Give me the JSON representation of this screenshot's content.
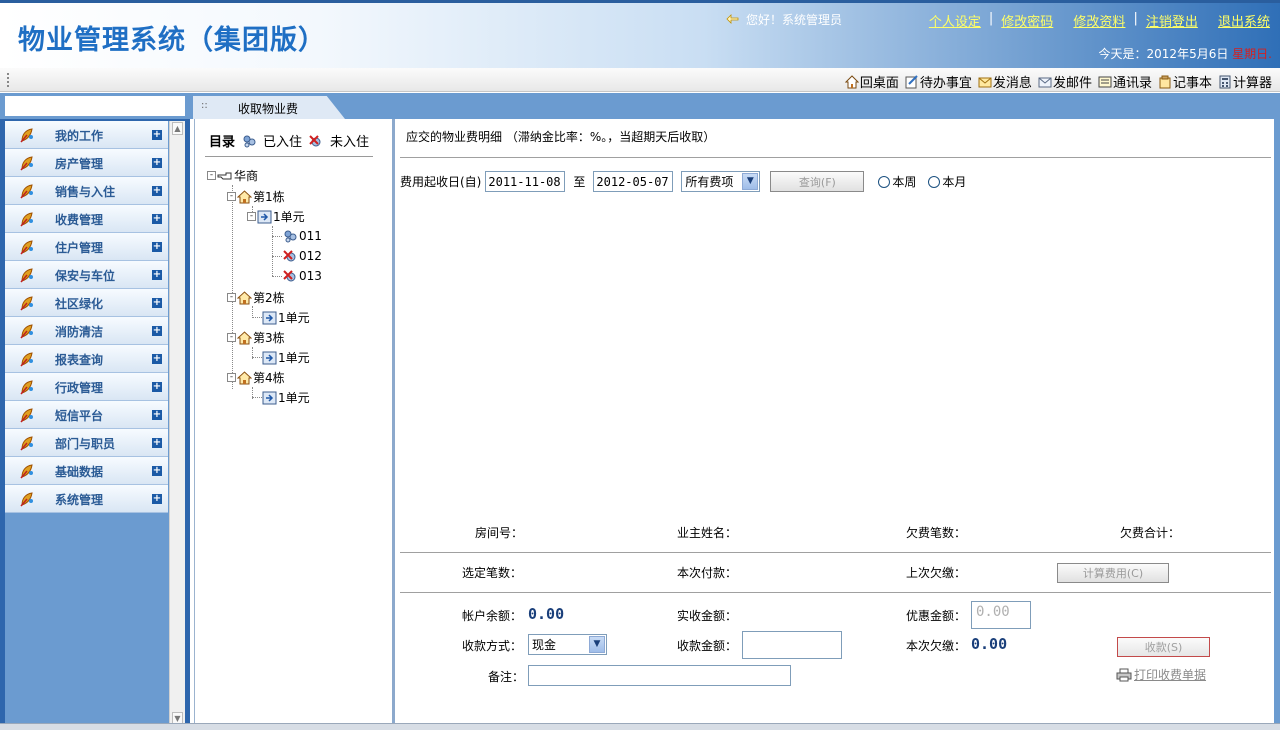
{
  "header": {
    "title": "物业管理系统（集团版）",
    "welcome": "您好！系统管理员",
    "links": [
      "个人设定",
      "修改密码",
      "修改资料",
      "注销登出",
      "退出系统"
    ],
    "date_prefix": "今天是：2012年5月6日",
    "weekday": "星期日."
  },
  "toolbar": {
    "items": [
      {
        "label": "回桌面",
        "icon": "home-icon"
      },
      {
        "label": "待办事宜",
        "icon": "todo-icon"
      },
      {
        "label": "发消息",
        "icon": "message-icon"
      },
      {
        "label": "发邮件",
        "icon": "mail-icon"
      },
      {
        "label": "通讯录",
        "icon": "contacts-icon"
      },
      {
        "label": "记事本",
        "icon": "notepad-icon"
      },
      {
        "label": "计算器",
        "icon": "calculator-icon"
      }
    ]
  },
  "tab": {
    "label": "收取物业费"
  },
  "nav": {
    "items": [
      "我的工作",
      "房产管理",
      "销售与入住",
      "收费管理",
      "住户管理",
      "保安与车位",
      "社区绿化",
      "消防清洁",
      "报表查询",
      "行政管理",
      "短信平台",
      "部门与职员",
      "基础数据",
      "系统管理"
    ]
  },
  "tree": {
    "catalog": "目录",
    "legend_in": "已入住",
    "legend_out": "未入住",
    "root": "华商",
    "buildings": [
      {
        "name": "第1栋",
        "unit": "1单元",
        "rooms": [
          "011",
          "012",
          "013"
        ]
      },
      {
        "name": "第2栋",
        "unit": "1单元"
      },
      {
        "name": "第3栋",
        "unit": "1单元"
      },
      {
        "name": "第4栋",
        "unit": "1单元"
      }
    ]
  },
  "main": {
    "heading": "应交的物业费明细 （滞纳金比率：%。，当超期天后收取）",
    "filter": {
      "start_label": "费用起收日(自)",
      "start_date": "2011-11-08",
      "to_label": "至",
      "end_date": "2012-05-07",
      "fee_type": "所有费项",
      "query_button": "查询(F)",
      "radio_week": "本周",
      "radio_month": "本月"
    },
    "summary": {
      "room_label": "房间号：",
      "owner_label": "业主姓名：",
      "arrears_count_label": "欠费笔数：",
      "arrears_total_label": "欠费合计：",
      "selected_label": "选定笔数：",
      "this_payment_label": "本次付款：",
      "last_arrears_label": "上次欠缴：",
      "calc_button": "计算费用(C)"
    },
    "payment": {
      "balance_label": "帐户余额：",
      "balance_value": "0.00",
      "actual_label": "实收金额：",
      "discount_label": "优惠金额：",
      "discount_value": "0.00",
      "method_label": "收款方式：",
      "method_value": "现金",
      "amount_label": "收款金额：",
      "current_arrears_label": "本次欠缴：",
      "current_arrears_value": "0.00",
      "receive_button": "收款(S)",
      "note_label": "备注：",
      "print_link": "打印收费单据"
    }
  }
}
